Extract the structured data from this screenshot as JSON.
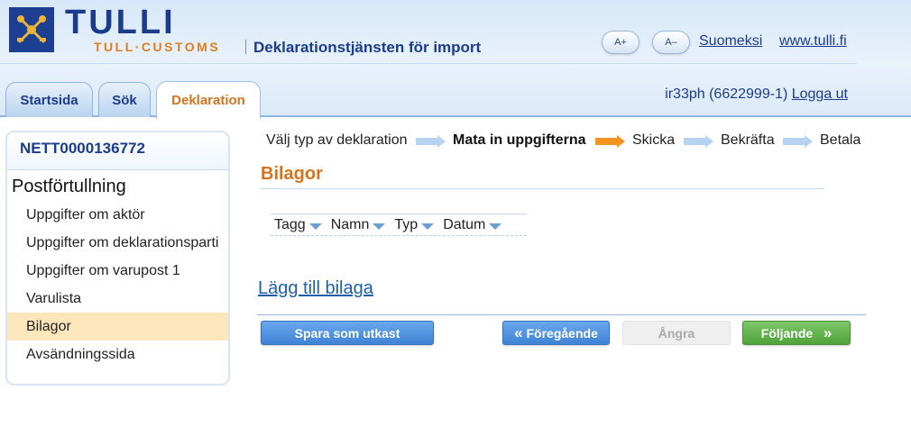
{
  "header": {
    "logo_main": "TULLI",
    "logo_sub": "TULL·CUSTOMS",
    "service_title": "Deklarationstjänsten för import",
    "font_increase": "A+",
    "font_decrease": "A–",
    "language_link": "Suomeksi",
    "site_link": "www.tulli.fi"
  },
  "tabs": [
    {
      "label": "Startsida",
      "active": false
    },
    {
      "label": "Sök",
      "active": false
    },
    {
      "label": "Deklaration",
      "active": true
    }
  ],
  "user": {
    "id_text": "ir33ph (6622999-1)",
    "logout": "Logga ut"
  },
  "sidebar": {
    "declaration_id": "NETT0000136772",
    "section": "Postförtullning",
    "items": [
      {
        "label": "Uppgifter om aktör",
        "selected": false
      },
      {
        "label": "Uppgifter om deklarationsparti",
        "selected": false
      },
      {
        "label": "Uppgifter om varupost 1",
        "selected": false
      },
      {
        "label": "Varulista",
        "selected": false
      },
      {
        "label": "Bilagor",
        "selected": true
      },
      {
        "label": "Avsändningssida",
        "selected": false
      }
    ]
  },
  "steps": [
    {
      "label": "Välj typ av deklaration",
      "current": false
    },
    {
      "label": "Mata in uppgifterna",
      "current": true
    },
    {
      "label": "Skicka",
      "current": false
    },
    {
      "label": "Bekräfta",
      "current": false
    },
    {
      "label": "Betala",
      "current": false
    }
  ],
  "main": {
    "title": "Bilagor",
    "table_headers": [
      "Tagg",
      "Namn",
      "Typ",
      "Datum"
    ],
    "add_link": "Lägg till bilaga"
  },
  "actions": {
    "save_draft": "Spara som utkast",
    "previous": "Föregående",
    "undo": "Ångra",
    "next": "Följande"
  },
  "colors": {
    "brand_blue": "#1b3c8c",
    "accent_orange": "#d6731c",
    "selected_bg": "#fde6bb",
    "next_green": "#4fa33a"
  }
}
